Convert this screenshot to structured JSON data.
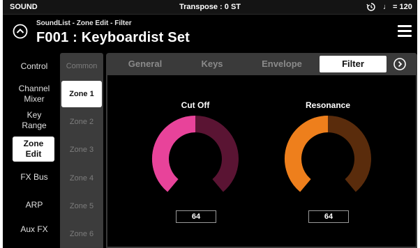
{
  "status": {
    "mode": "SOUND",
    "transpose": "Transpose : 0 ST",
    "tempo": "♩ = 120"
  },
  "header": {
    "breadcrumb": "SoundList - Zone Edit - Filter",
    "title": "F001 : Keyboardist Set"
  },
  "categories": [
    {
      "label": "Control"
    },
    {
      "label": "Channel\nMixer"
    },
    {
      "label": "Key\nRange"
    },
    {
      "label": "Zone\nEdit"
    },
    {
      "label": "FX Bus"
    },
    {
      "label": "ARP"
    },
    {
      "label": "Aux FX"
    }
  ],
  "zones": [
    {
      "label": "Common"
    },
    {
      "label": "Zone 1"
    },
    {
      "label": "Zone 2"
    },
    {
      "label": "Zone 3"
    },
    {
      "label": "Zone 4"
    },
    {
      "label": "Zone 5"
    },
    {
      "label": "Zone 6"
    }
  ],
  "tabs": [
    {
      "label": "General"
    },
    {
      "label": "Keys"
    },
    {
      "label": "Envelope"
    },
    {
      "label": "Filter"
    }
  ],
  "knobs": [
    {
      "label": "Cut Off",
      "value": "64",
      "color": "#e8439a",
      "track": "#5a1433",
      "level": 0.5
    },
    {
      "label": "Resonance",
      "value": "64",
      "color": "#ee7f1c",
      "track": "#5a2c0c",
      "level": 0.5
    }
  ]
}
